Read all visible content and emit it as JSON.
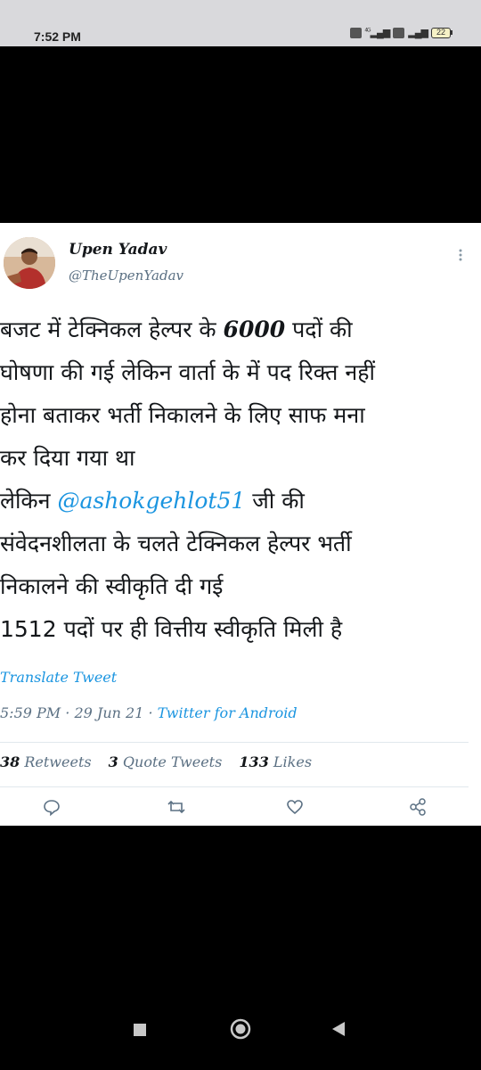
{
  "status_bar": {
    "time": "7:52 PM",
    "battery": "22",
    "signal_label": "4G"
  },
  "tweet": {
    "name": "Upen Yadav",
    "handle": "@TheUpenYadav",
    "text_lines": [
      {
        "before": "बजट में टेक्निकल हेल्पर के ",
        "num": "6000",
        "after": " पदों की"
      },
      {
        "text": "घोषणा की गई लेकिन वार्ता के में पद रिक्त नहीं"
      },
      {
        "text": "होना बताकर भर्ती निकालने के लिए साफ मना"
      },
      {
        "text": "कर दिया गया था"
      },
      {
        "before": "लेकिन ",
        "mention": "@ashokgehlot51",
        "after": " जी की"
      },
      {
        "text": "संवेदनशीलता के चलते टेक्निकल हेल्पर भर्ती"
      },
      {
        "text": "निकालने की स्वीकृति दी गई"
      },
      {
        "text": "1512 पदों पर ही वित्तीय स्वीकृति मिली है"
      }
    ],
    "translate_label": "Translate Tweet",
    "time": "5:59 PM",
    "date": "29 Jun 21",
    "source": "Twitter for Android",
    "separator": "·",
    "retweets_count": "38",
    "retweets_label": "Retweets",
    "quotes_count": "3",
    "quotes_label": "Quote Tweets",
    "likes_count": "133",
    "likes_label": "Likes"
  },
  "icons": {
    "reply": "reply-icon",
    "retweet": "retweet-icon",
    "like": "heart-icon",
    "share": "share-icon",
    "more": "more-vertical-icon"
  },
  "colors": {
    "link": "#1b95e0",
    "secondary_text": "#5b7083",
    "primary_text": "#14171a",
    "status_bar": "#d9d9dc",
    "background": "#000000"
  }
}
